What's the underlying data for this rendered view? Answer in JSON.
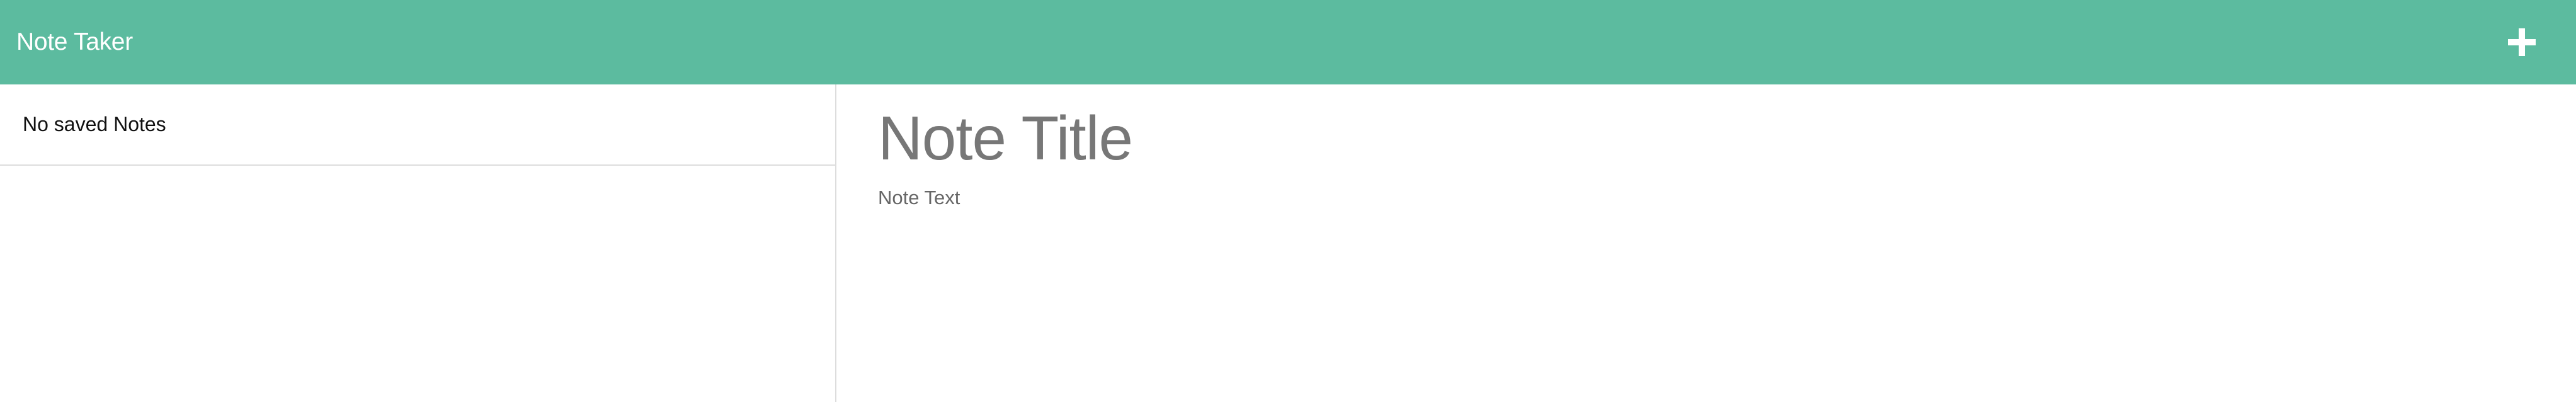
{
  "header": {
    "brand": "Note Taker",
    "new_note_icon": "plus-icon",
    "background_color": "#5cbb9f"
  },
  "sidebar": {
    "empty_message": "No saved Notes"
  },
  "editor": {
    "title_placeholder": "Note Title",
    "text_placeholder": "Note Text",
    "title_value": "",
    "text_value": ""
  }
}
